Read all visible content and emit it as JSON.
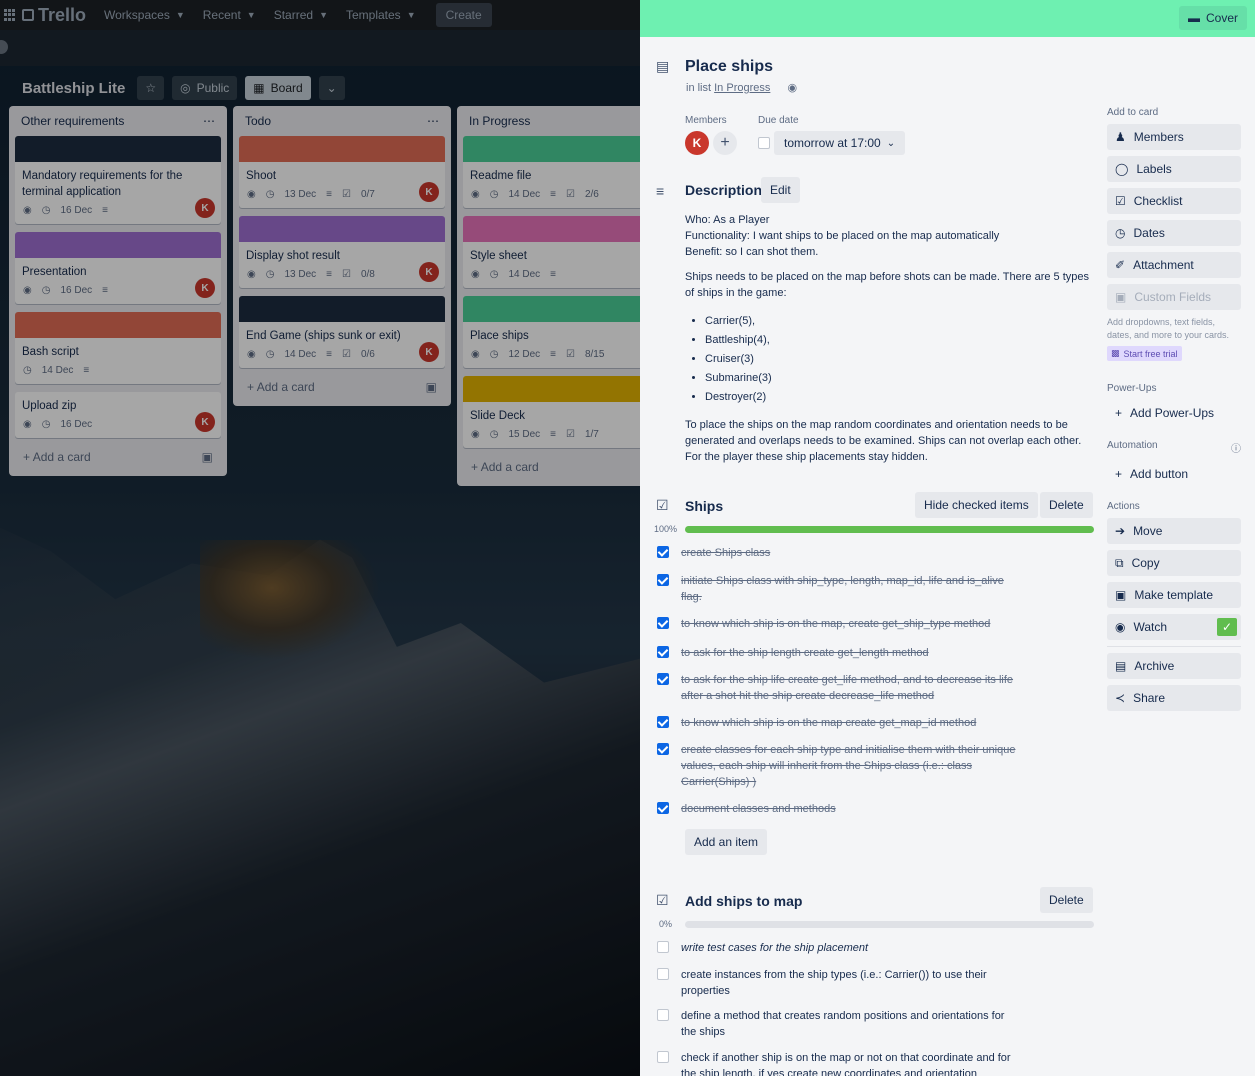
{
  "topnav": {
    "logo": "Trello",
    "items": [
      "Workspaces",
      "Recent",
      "Starred",
      "Templates"
    ],
    "create": "Create"
  },
  "board": {
    "title": "Battleship Lite",
    "visibility": "Public",
    "view": "Board"
  },
  "lists": [
    {
      "title": "Other requirements",
      "cards": [
        {
          "title": "Mandatory requirements for the terminal application",
          "date": "16 Dec",
          "cover": "#1d2b3f",
          "watch": true,
          "desc": true,
          "avatar": "K"
        },
        {
          "title": "Presentation",
          "date": "16 Dec",
          "cover": "#9f6fd1",
          "watch": true,
          "desc": true,
          "avatar": "K"
        },
        {
          "title": "Bash script",
          "date": "14 Dec",
          "cover": "#e06c55",
          "watch": false,
          "desc": true,
          "avatar": ""
        },
        {
          "title": "Upload zip",
          "date": "16 Dec",
          "cover": "",
          "watch": true,
          "desc": false,
          "avatar": "K"
        }
      ],
      "add": "Add a card"
    },
    {
      "title": "Todo",
      "cards": [
        {
          "title": "Shoot",
          "date": "13 Dec",
          "cover": "#e06c55",
          "watch": true,
          "desc": true,
          "check": "0/7",
          "avatar": "K"
        },
        {
          "title": "Display shot result",
          "date": "13 Dec",
          "cover": "#9f6fd1",
          "watch": true,
          "desc": true,
          "check": "0/8",
          "avatar": "K"
        },
        {
          "title": "End Game (ships sunk or exit)",
          "date": "14 Dec",
          "cover": "#1d2b3f",
          "watch": true,
          "desc": true,
          "check": "0/6",
          "avatar": "K"
        }
      ],
      "add": "Add a card"
    },
    {
      "title": "In Progress",
      "cards": [
        {
          "title": "Readme file",
          "date": "14 Dec",
          "cover": "#4bce97",
          "watch": true,
          "desc": true,
          "check": "2/6"
        },
        {
          "title": "Style sheet",
          "date": "14 Dec",
          "cover": "#e774bb",
          "watch": true,
          "desc": true
        },
        {
          "title": "Place ships",
          "date": "12 Dec",
          "cover": "#6ef0b1",
          "watch": true,
          "desc": true,
          "check": "8/15"
        },
        {
          "title": "Slide Deck",
          "date": "15 Dec",
          "cover": "#e2b203",
          "watch": true,
          "desc": true,
          "check": "1/7"
        }
      ],
      "add": "Add a card"
    }
  ],
  "panel": {
    "cover_btn": "Cover",
    "title": "Place ships",
    "in_list_prefix": "in list ",
    "in_list": "In Progress",
    "members_label": "Members",
    "member_initial": "K",
    "due_label": "Due date",
    "due_value": "tomorrow at 17:00",
    "description_label": "Description",
    "edit": "Edit",
    "desc_lines": [
      "Who: As a Player",
      "Functionality: I want ships to be placed on the map automatically",
      "Benefit: so I can shot them."
    ],
    "desc_para": "Ships needs to be placed on the map before shots can be made. There are 5 types of ships in the game:",
    "desc_bullets": [
      "Carrier(5),",
      "Battleship(4),",
      "Cruiser(3)",
      "Submarine(3)",
      "Destroyer(2)"
    ],
    "desc_para2": "To place the ships on the map random coordinates and orientation needs to be generated and overlaps needs to be examined. Ships can not overlap each other. For the player these ship placements stay hidden.",
    "checklist1": {
      "title": "Ships",
      "hide": "Hide checked items",
      "delete": "Delete",
      "percent": "100%",
      "progress": 1.0,
      "items": [
        "create Ships class",
        "initiate Ships class with ship_type, length, map_id, life and is_alive flag.",
        "to know which ship is on the map, create get_ship_type method",
        "to ask for the ship length create get_length method",
        "to ask for the ship life create get_life method, and to decrease its life after a shot hit the ship create decrease_life method",
        "to know which ship is on the map create get_map_id method",
        "create classes for each ship type and initialise them with their unique values, each ship will inherit from the Ships class (i.e.: class Carrier(Ships) )",
        "document classes and methods"
      ],
      "add_item": "Add an item"
    },
    "checklist2": {
      "title": "Add ships to map",
      "delete": "Delete",
      "percent": "0%",
      "progress": 0.0,
      "items": [
        "write test cases for the ship placement",
        "create instances from the ship types (i.e.: Carrier()) to use their properties",
        "define a method that creates random positions and orientations for the ships",
        "check if another ship is on the map or not on that coordinate and for the ship length, if yes create new coordinates and orientation"
      ]
    },
    "side": {
      "add_to_card": "Add to card",
      "buttons": [
        "Members",
        "Labels",
        "Checklist",
        "Dates",
        "Attachment"
      ],
      "custom_fields": "Custom Fields",
      "custom_note": "Add dropdowns, text fields, dates, and more to your cards.",
      "trial": "Start free trial",
      "powerups_label": "Power-Ups",
      "add_powerups": "Add Power-Ups",
      "automation_label": "Automation",
      "add_button": "Add button",
      "actions_label": "Actions",
      "actions": [
        "Move",
        "Copy",
        "Make template",
        "Watch",
        "Archive",
        "Share"
      ]
    }
  }
}
